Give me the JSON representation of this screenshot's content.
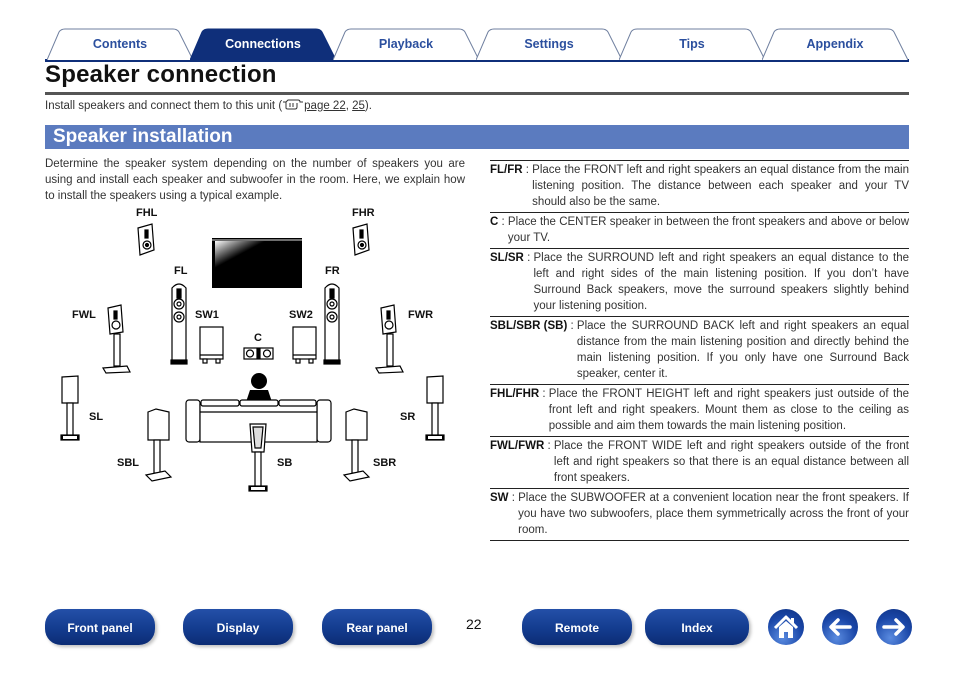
{
  "tabs": [
    {
      "label": "Contents",
      "active": false
    },
    {
      "label": "Connections",
      "active": true
    },
    {
      "label": "Playback",
      "active": false
    },
    {
      "label": "Settings",
      "active": false
    },
    {
      "label": "Tips",
      "active": false
    },
    {
      "label": "Appendix",
      "active": false
    }
  ],
  "colors": {
    "brand_navy": "#0f2f7a",
    "tab_text": "#2b4f9e",
    "section_bar": "#5b7bbf",
    "button_blue": "#123a8c"
  },
  "page": {
    "title": "Speaker connection",
    "intro_prefix": "Install speakers and connect them to this unit (",
    "intro_icon": "hand-pointer-icon",
    "intro_link1": "page 22",
    "intro_sep": ", ",
    "intro_link2": "25",
    "intro_suffix": ").",
    "section_title": "Speaker installation",
    "description": "Determine the speaker system depending on the number of speakers you are using and install each speaker and subwoofer in the room. Here, we explain how to install the speakers using a typical example."
  },
  "diagram": {
    "labels": {
      "fhl": "FHL",
      "fhr": "FHR",
      "fl": "FL",
      "fr": "FR",
      "fwl": "FWL",
      "fwr": "FWR",
      "sw1": "SW1",
      "sw2": "SW2",
      "c": "C",
      "sl": "SL",
      "sr": "SR",
      "sbl": "SBL",
      "sb": "SB",
      "sbr": "SBR"
    }
  },
  "definitions": [
    {
      "term": "FL/FR",
      "text": "Place the FRONT left and right speakers an equal distance from the main listening position. The distance between each speaker and your TV should also be the same."
    },
    {
      "term": "C",
      "text": "Place the CENTER speaker in between the front speakers and above or below your TV."
    },
    {
      "term": "SL/SR",
      "text": "Place the SURROUND left and right speakers an equal distance to the left and right sides of the main listening position. If you don’t have Surround Back speakers, move the surround speakers slightly behind your listening position."
    },
    {
      "term": "SBL/SBR (SB)",
      "text": "Place the SURROUND BACK left and right speakers an equal distance from the main listening position and directly behind the main listening position. If you only have one Surround Back speaker, center it."
    },
    {
      "term": "FHL/FHR",
      "text": "Place the FRONT HEIGHT left and right speakers just outside of the front left and right speakers. Mount them as close to the ceiling as possible and aim them towards the main listening position."
    },
    {
      "term": "FWL/FWR",
      "text": "Place the FRONT WIDE left and right speakers outside of the front left and right speakers so that there is an equal distance between all front speakers."
    },
    {
      "term": "SW",
      "text": "Place the SUBWOOFER at a convenient location near the front speakers. If you have two subwoofers, place them symmetrically across the front of your room."
    }
  ],
  "footer": {
    "buttons": [
      "Front panel",
      "Display",
      "Rear panel",
      "Remote",
      "Index"
    ],
    "page_number": "22",
    "icons": [
      "home-icon",
      "back-arrow-icon",
      "forward-arrow-icon"
    ]
  }
}
